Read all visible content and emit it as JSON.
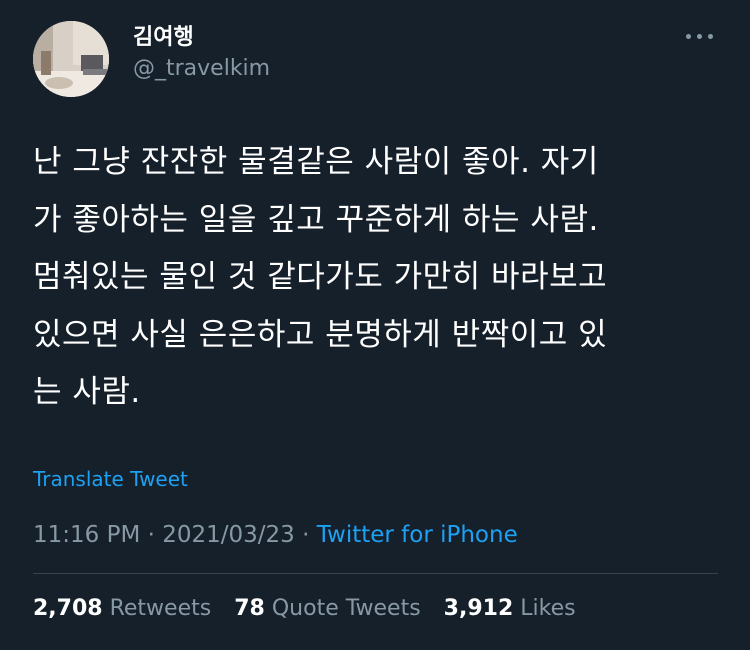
{
  "user": {
    "display_name": "김여행",
    "handle": "@_travelkim"
  },
  "menu": {
    "icon": "more-horizontal-icon"
  },
  "tweet": {
    "text": "난 그냥 잔잔한 물결같은 사람이 좋아. 자기\n가 좋아하는 일을 깊고 꾸준하게 하는 사람.\n멈춰있는 물인 것 같다가도 가만히 바라보고\n있으면 사실 은은하고 분명하게 반짝이고 있\n는 사람.",
    "translate_label": "Translate Tweet",
    "time": "11:16 PM",
    "sep1": " · ",
    "date": "2021/03/23",
    "sep2": " · ",
    "source": "Twitter for iPhone"
  },
  "stats": {
    "retweets": {
      "count": "2,708",
      "label": "Retweets"
    },
    "quote_tweets": {
      "count": "78",
      "label": "Quote Tweets"
    },
    "likes": {
      "count": "3,912",
      "label": "Likes"
    }
  },
  "colors": {
    "background": "#15202b",
    "text_primary": "#ffffff",
    "text_secondary": "#8899a6",
    "accent": "#1da1f2",
    "divider": "#38444d"
  }
}
